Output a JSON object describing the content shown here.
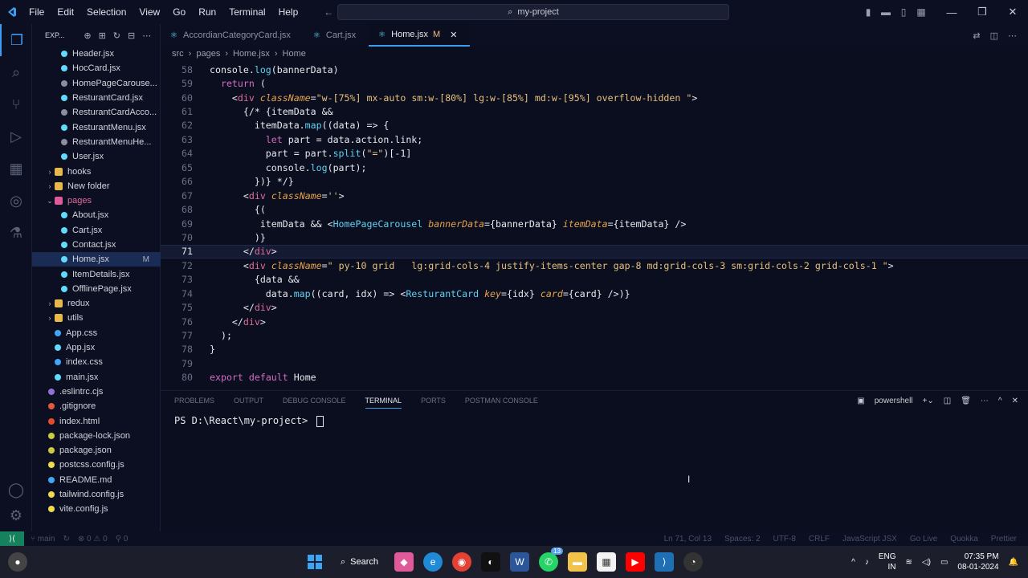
{
  "titlebar": {
    "menu": [
      "File",
      "Edit",
      "Selection",
      "View",
      "Go",
      "Run",
      "Terminal",
      "Help"
    ],
    "command_center": "my-project"
  },
  "sidebar": {
    "title": "EXP...",
    "items": [
      {
        "label": "Header.jsx",
        "type": "file",
        "depth": 2
      },
      {
        "label": "HocCard.jsx",
        "type": "file",
        "depth": 2
      },
      {
        "label": "HomePageCarouse...",
        "type": "file",
        "depth": 2
      },
      {
        "label": "ResturantCard.jsx",
        "type": "file",
        "depth": 2
      },
      {
        "label": "ResturantCardAcco...",
        "type": "file",
        "depth": 2
      },
      {
        "label": "ResturantMenu.jsx",
        "type": "file",
        "depth": 2
      },
      {
        "label": "ResturantMenuHe...",
        "type": "file",
        "depth": 2
      },
      {
        "label": "User.jsx",
        "type": "file",
        "depth": 2
      },
      {
        "label": "hooks",
        "type": "folder",
        "depth": 1
      },
      {
        "label": "New folder",
        "type": "folder",
        "depth": 1
      },
      {
        "label": "pages",
        "type": "folder-open",
        "depth": 1
      },
      {
        "label": "About.jsx",
        "type": "file",
        "depth": 2
      },
      {
        "label": "Cart.jsx",
        "type": "file",
        "depth": 2
      },
      {
        "label": "Contact.jsx",
        "type": "file",
        "depth": 2
      },
      {
        "label": "Home.jsx",
        "type": "file",
        "depth": 2,
        "selected": true,
        "badge": "M"
      },
      {
        "label": "ItemDetails.jsx",
        "type": "file",
        "depth": 2
      },
      {
        "label": "OfflinePage.jsx",
        "type": "file",
        "depth": 2
      },
      {
        "label": "redux",
        "type": "folder",
        "depth": 1
      },
      {
        "label": "utils",
        "type": "folder",
        "depth": 1
      },
      {
        "label": "App.css",
        "type": "file",
        "depth": 1
      },
      {
        "label": "App.jsx",
        "type": "file",
        "depth": 1
      },
      {
        "label": "index.css",
        "type": "file",
        "depth": 1
      },
      {
        "label": "main.jsx",
        "type": "file",
        "depth": 1
      },
      {
        "label": ".eslintrc.cjs",
        "type": "file",
        "depth": 0
      },
      {
        "label": ".gitignore",
        "type": "file",
        "depth": 0
      },
      {
        "label": "index.html",
        "type": "file",
        "depth": 0
      },
      {
        "label": "package-lock.json",
        "type": "file",
        "depth": 0
      },
      {
        "label": "package.json",
        "type": "file",
        "depth": 0
      },
      {
        "label": "postcss.config.js",
        "type": "file",
        "depth": 0
      },
      {
        "label": "README.md",
        "type": "file",
        "depth": 0
      },
      {
        "label": "tailwind.config.js",
        "type": "file",
        "depth": 0
      },
      {
        "label": "vite.config.js",
        "type": "file",
        "depth": 0
      }
    ]
  },
  "tabs": [
    {
      "label": "AccordianCategoryCard.jsx",
      "active": false
    },
    {
      "label": "Cart.jsx",
      "active": false
    },
    {
      "label": "Home.jsx",
      "active": true,
      "badge": "M"
    }
  ],
  "breadcrumb": [
    "src",
    "pages",
    "Home.jsx",
    "Home"
  ],
  "code": {
    "current_line": 71,
    "lines": [
      {
        "n": 58,
        "text": "console.log(bannerData)"
      },
      {
        "n": 59,
        "text": "  return ("
      },
      {
        "n": 60,
        "text": "    <div className=\"w-[75%] mx-auto sm:w-[80%] lg:w-[85%] md:w-[95%] overflow-hidden \">"
      },
      {
        "n": 61,
        "text": "      {/* {itemData &&"
      },
      {
        "n": 62,
        "text": "        itemData.map((data) => {"
      },
      {
        "n": 63,
        "text": "          let part = data.action.link;"
      },
      {
        "n": 64,
        "text": "          part = part.split(\"=\")[-1]"
      },
      {
        "n": 65,
        "text": "          console.log(part);"
      },
      {
        "n": 66,
        "text": "        })} */}"
      },
      {
        "n": 67,
        "text": "      <div className=''>"
      },
      {
        "n": 68,
        "text": "        {("
      },
      {
        "n": 69,
        "text": "         itemData && <HomePageCarousel bannerData={bannerData} itemData={itemData} />"
      },
      {
        "n": 70,
        "text": "        )}"
      },
      {
        "n": 71,
        "text": "      </div>"
      },
      {
        "n": 72,
        "text": "      <div className=\" py-10 grid   lg:grid-cols-4 justify-items-center gap-8 md:grid-cols-3 sm:grid-cols-2 grid-cols-1 \">"
      },
      {
        "n": 73,
        "text": "        {data &&"
      },
      {
        "n": 74,
        "text": "          data.map((card, idx) => <ResturantCard key={idx} card={card} />)}"
      },
      {
        "n": 75,
        "text": "      </div>"
      },
      {
        "n": 76,
        "text": "    </div>"
      },
      {
        "n": 77,
        "text": "  );"
      },
      {
        "n": 78,
        "text": "}"
      },
      {
        "n": 79,
        "text": ""
      },
      {
        "n": 80,
        "text": "export default Home"
      }
    ]
  },
  "panel": {
    "tabs": [
      "PROBLEMS",
      "OUTPUT",
      "DEBUG CONSOLE",
      "TERMINAL",
      "PORTS",
      "POSTMAN CONSOLE"
    ],
    "active_tab": "TERMINAL",
    "shell": "powershell",
    "prompt": "PS D:\\React\\my-project> "
  },
  "status": {
    "branch": "main",
    "errors": "0",
    "warnings": "0",
    "sync": "0",
    "position": "Ln 71, Col 13",
    "spaces": "Spaces: 2",
    "encoding": "UTF-8",
    "eol": "CRLF",
    "language": "JavaScript JSX",
    "golive": "Go Live",
    "quokka": "Quokka",
    "prettier": "Prettier"
  },
  "taskbar": {
    "search": "Search",
    "lang": "ENG",
    "region": "IN",
    "time": "07:35 PM",
    "date": "08-01-2024",
    "whatsapp_badge": "13"
  }
}
